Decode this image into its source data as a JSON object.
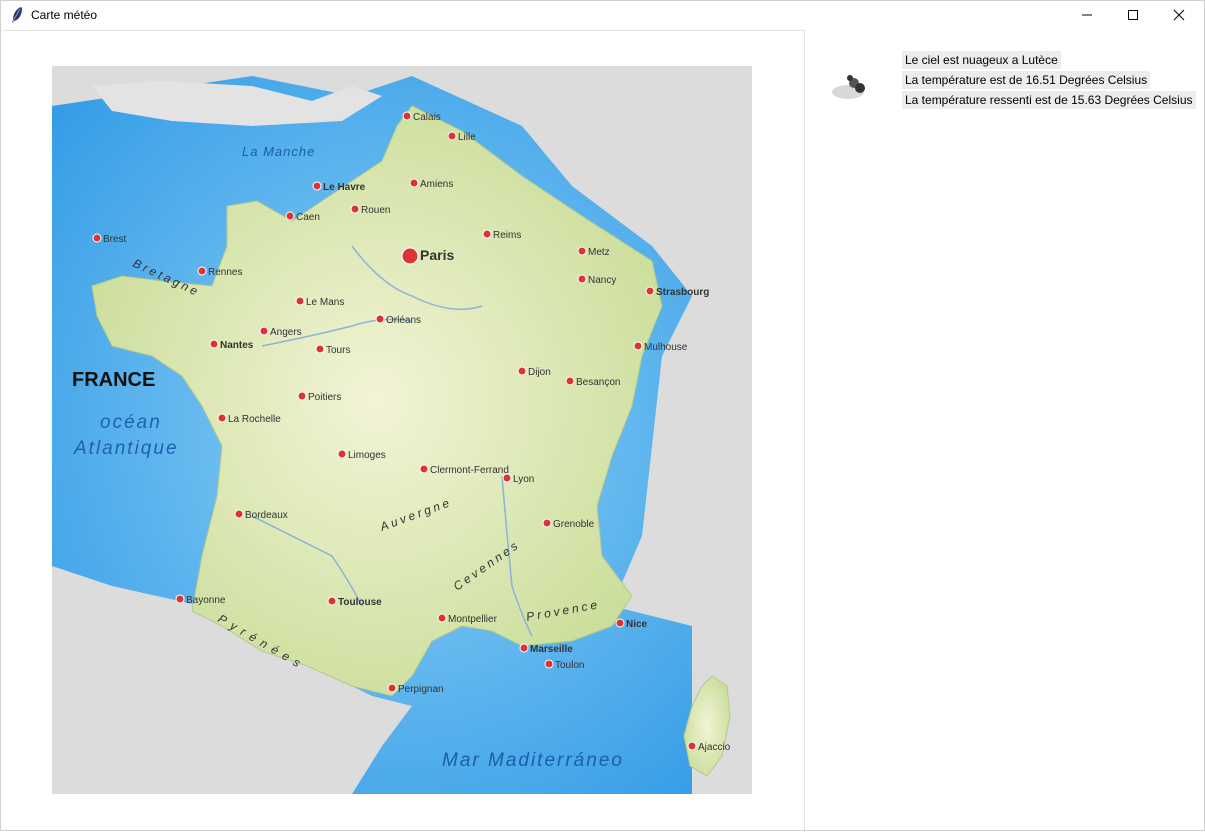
{
  "window": {
    "title": "Carte météo",
    "controls": [
      "minimize-icon",
      "maximize-icon",
      "close-icon"
    ]
  },
  "map": {
    "country_label": "FRANCE",
    "ocean_label_1": "océan",
    "ocean_label_2": "Atlantique",
    "sea_label": "Mar Maditerráneo",
    "manche_label": "La Manche",
    "region_labels": [
      "Bretagne",
      "Auvergne",
      "Cevennes",
      "Pyrénées",
      "Provence"
    ],
    "cities": [
      {
        "name": "Paris",
        "capital": true
      },
      {
        "name": "Lille"
      },
      {
        "name": "Calais"
      },
      {
        "name": "Amiens"
      },
      {
        "name": "Le Havre"
      },
      {
        "name": "Rouen"
      },
      {
        "name": "Caen"
      },
      {
        "name": "Brest"
      },
      {
        "name": "Rennes"
      },
      {
        "name": "Le Mans"
      },
      {
        "name": "Nantes"
      },
      {
        "name": "Angers"
      },
      {
        "name": "Tours"
      },
      {
        "name": "Orléans"
      },
      {
        "name": "Reims"
      },
      {
        "name": "Metz"
      },
      {
        "name": "Nancy"
      },
      {
        "name": "Strasbourg"
      },
      {
        "name": "Dijon"
      },
      {
        "name": "Mulhouse"
      },
      {
        "name": "Besançon"
      },
      {
        "name": "Lyon"
      },
      {
        "name": "Grenoble"
      },
      {
        "name": "Clermont-Ferrand"
      },
      {
        "name": "Limoges"
      },
      {
        "name": "Poitiers"
      },
      {
        "name": "La Rochelle"
      },
      {
        "name": "Bordeaux"
      },
      {
        "name": "Toulouse"
      },
      {
        "name": "Montpellier"
      },
      {
        "name": "Marseille"
      },
      {
        "name": "Nice"
      },
      {
        "name": "Toulon"
      },
      {
        "name": "Perpignan"
      },
      {
        "name": "Bayonne"
      },
      {
        "name": "Ajaccio"
      }
    ]
  },
  "weather": {
    "icon": "cloud-icon",
    "sky": "Le ciel est nuageux a Lutèce",
    "temperature": "La température est de 16.51 Degrées Celsius",
    "feels_like": "La température ressenti est de 15.63 Degrées Celsius"
  }
}
